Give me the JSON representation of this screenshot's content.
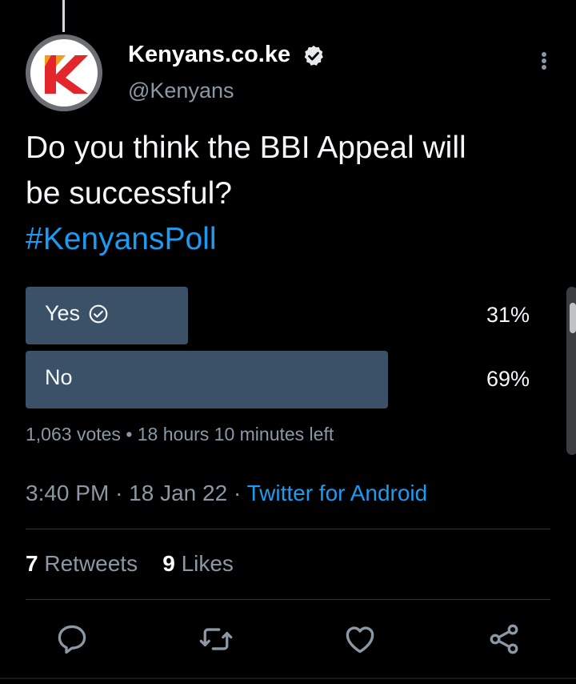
{
  "tweet": {
    "display_name": "Kenyans.co.ke",
    "handle": "@Kenyans",
    "avatar_logo_letter": "K",
    "text_line1": "Do you think the BBI Appeal will",
    "text_line2": "be successful?",
    "hashtag": "#KenyansPoll"
  },
  "poll": {
    "options": [
      {
        "label": "Yes",
        "percent": "31%",
        "fraction": 0.31,
        "selected": true
      },
      {
        "label": "No",
        "percent": "69%",
        "fraction": 0.69,
        "selected": false
      }
    ],
    "votes": "1,063 votes",
    "separator": "•",
    "time_left": "18 hours 10 minutes left"
  },
  "meta": {
    "time": "3:40 PM",
    "dot": "·",
    "date": "18 Jan 22",
    "source": "Twitter for Android"
  },
  "stats": {
    "retweets_count": "7",
    "retweets_label": "Retweets",
    "likes_count": "9",
    "likes_label": "Likes"
  },
  "colors": {
    "background": "#000000",
    "accent": "#1d9bf0",
    "poll_bar": "#3b5167",
    "muted_text": "#8b98a5",
    "logo_red": "#e3262c",
    "logo_orange": "#f39a1e"
  },
  "icons": [
    "verified-badge-icon",
    "more-options-icon",
    "check-circle-icon",
    "reply-icon",
    "retweet-icon",
    "like-icon",
    "share-icon"
  ]
}
